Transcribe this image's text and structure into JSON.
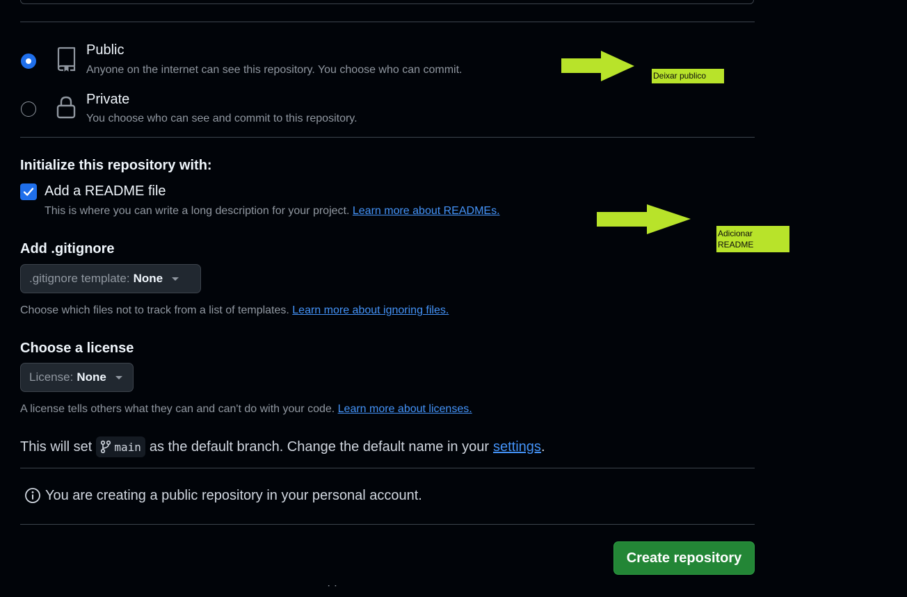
{
  "visibility": {
    "public": {
      "title": "Public",
      "description": "Anyone on the internet can see this repository. You choose who can commit.",
      "selected": true
    },
    "private": {
      "title": "Private",
      "description": "You choose who can see and commit to this repository.",
      "selected": false
    }
  },
  "initialize": {
    "title": "Initialize this repository with:",
    "readme": {
      "label": "Add a README file",
      "checked": true,
      "description": "This is where you can write a long description for your project.",
      "link": "Learn more about READMEs."
    }
  },
  "gitignore": {
    "title": "Add .gitignore",
    "dropdown_label": ".gitignore template:",
    "dropdown_value": "None",
    "description": "Choose which files not to track from a list of templates.",
    "link": "Learn more about ignoring files."
  },
  "license": {
    "title": "Choose a license",
    "dropdown_label": "License:",
    "dropdown_value": "None",
    "description": "A license tells others what they can and can't do with your code.",
    "link": "Learn more about licenses."
  },
  "branch": {
    "prefix": "This will set",
    "name": "main",
    "suffix": "as the default branch. Change the default name in your",
    "settings_link": "settings",
    "period": "."
  },
  "info": {
    "message": "You are creating a public repository in your personal account."
  },
  "create_button": {
    "label": "Create repository"
  },
  "annotations": {
    "note1": "Deixar publico",
    "note2_line1": "Adicionar",
    "note2_line2": "README",
    "color": "#b8e32a"
  },
  "icons": {
    "public": "repo-icon",
    "private": "lock-icon",
    "branch": "git-branch-icon",
    "info": "info-icon",
    "dropdown": "triangle-down-icon",
    "check": "check-icon"
  },
  "colors": {
    "background": "#010409",
    "accent": "#1f6feb",
    "link": "#4493f8",
    "primary_button": "#238636"
  }
}
